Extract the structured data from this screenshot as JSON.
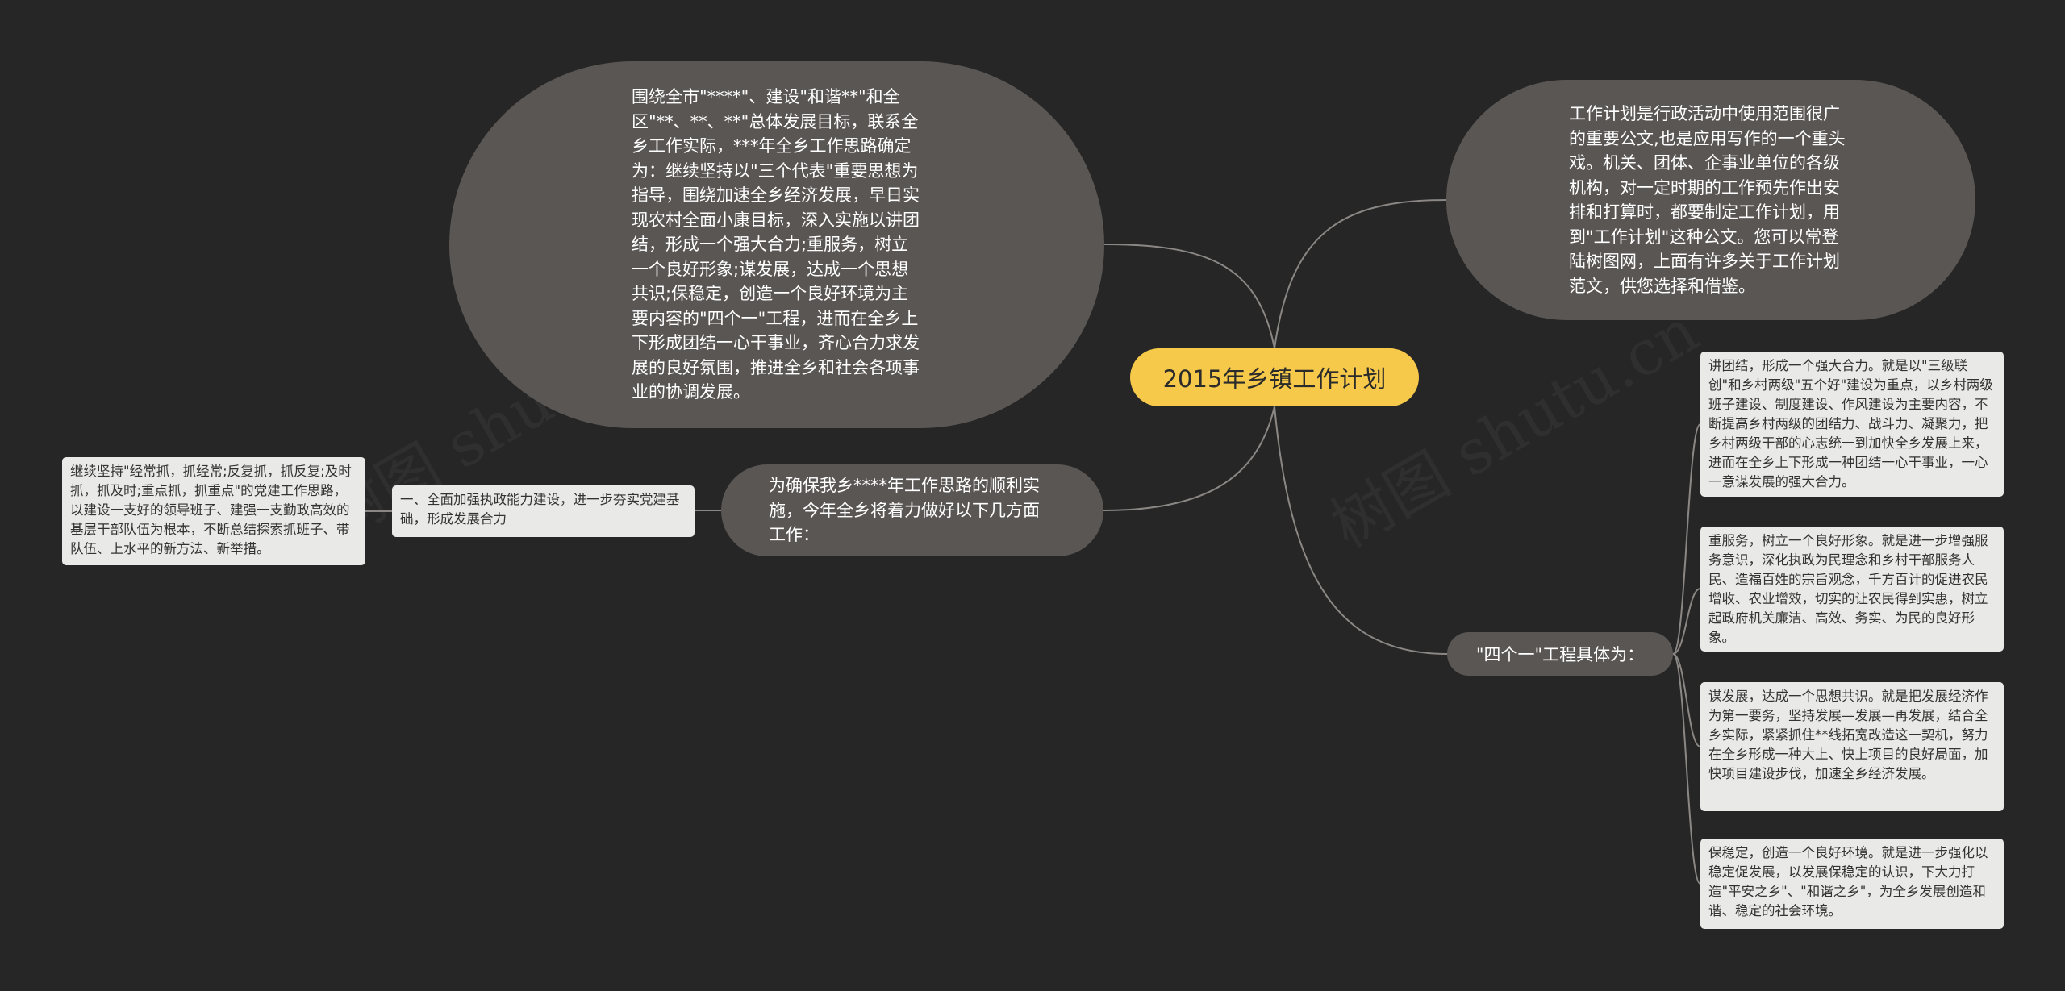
{
  "watermark": "树图 shutu.cn",
  "center": {
    "title": "2015年乡镇工作计划"
  },
  "main_idea": {
    "text": "围绕全市\"****\"、建设\"和谐**\"和全区\"**、**、**\"总体发展目标，联系全乡工作实际，***年全乡工作思路确定为：继续坚持以\"三个代表\"重要思想为指导，围绕加速全乡经济发展，早日实现农村全面小康目标，深入实施以讲团结，形成一个强大合力;重服务，树立一个良好形象;谋发展，达成一个思想共识;保稳定，创造一个良好环境为主要内容的\"四个一\"工程，进而在全乡上下形成团结一心干事业，齐心合力求发展的良好氛围，推进全乡和社会各项事业的协调发展。"
  },
  "intro": {
    "text": "工作计划是行政活动中使用范围很广的重要公文,也是应用写作的一个重头戏。机关、团体、企事业单位的各级机构，对一定时期的工作预先作出安排和打算时，都要制定工作计划，用到\"工作计划\"这种公文。您可以常登陆树图网，上面有许多关于工作计划范文，供您选择和借鉴。"
  },
  "plan": {
    "text": "为确保我乡****年工作思路的顺利实施，今年全乡将着力做好以下几方面工作：",
    "child": {
      "text": "一、全面加强执政能力建设，进一步夯实党建基础，形成发展合力",
      "child": {
        "text": "继续坚持\"经常抓，抓经常;反复抓，抓反复;及时抓，抓及时;重点抓，抓重点\"的党建工作思路，以建设一支好的领导班子、建强一支勤政高效的基层干部队伍为根本，不断总结探索抓班子、带队伍、上水平的新方法、新举措。"
      }
    }
  },
  "four": {
    "label": "\"四个一\"工程具体为：",
    "items": [
      {
        "text": "讲团结，形成一个强大合力。就是以\"三级联创\"和乡村两级\"五个好\"建设为重点，以乡村两级班子建设、制度建设、作风建设为主要内容，不断提高乡村两级的团结力、战斗力、凝聚力，把乡村两级干部的心志统一到加快全乡发展上来，进而在全乡上下形成一种团结一心干事业，一心一意谋发展的强大合力。"
      },
      {
        "text": "重服务，树立一个良好形象。就是进一步增强服务意识，深化执政为民理念和乡村干部服务人民、造福百姓的宗旨观念，千方百计的促进农民增收、农业增效，切实的让农民得到实惠，树立起政府机关廉洁、高效、务实、为民的良好形象。"
      },
      {
        "text": "谋发展，达成一个思想共识。就是把发展经济作为第一要务，坚持发展—发展—再发展，结合全乡实际，紧紧抓住**线拓宽改造这一契机，努力在全乡形成一种大上、快上项目的良好局面，加快项目建设步伐，加速全乡经济发展。"
      },
      {
        "text": "保稳定，创造一个良好环境。就是进一步强化以稳定促发展，以发展保稳定的认识，下大力打造\"平安之乡\"、\"和谐之乡\"，为全乡发展创造和谐、稳定的社会环境。"
      }
    ]
  },
  "colors": {
    "background": "#262626",
    "center_fill": "#f6c94a",
    "bubble_fill": "#5a5654",
    "card_fill": "#e9e9e7",
    "link": "#8a8784"
  }
}
